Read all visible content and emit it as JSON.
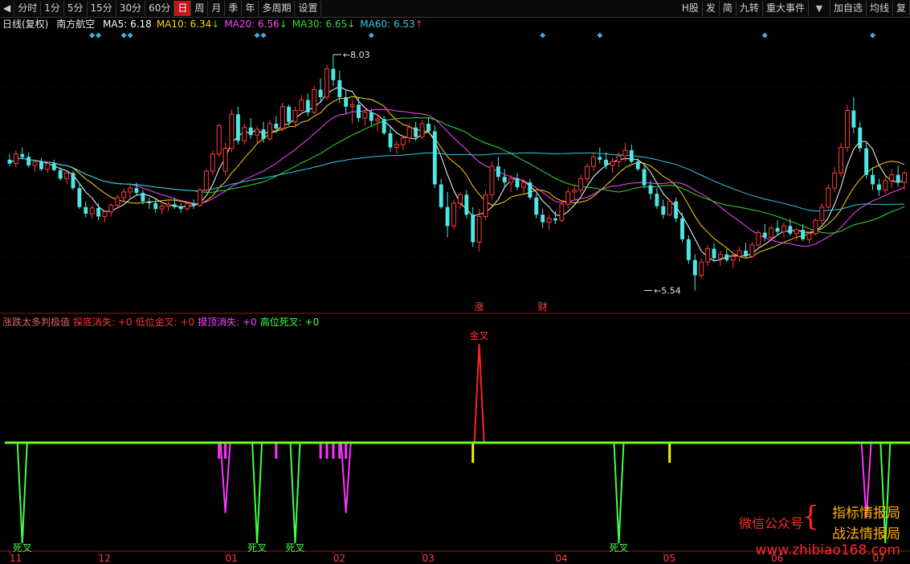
{
  "toolbar": {
    "back_icon": "arrow-left-icon",
    "periods": [
      "分时",
      "1分",
      "5分",
      "15分",
      "30分",
      "60分",
      "日",
      "周",
      "月",
      "季",
      "年",
      "多周期",
      "设置"
    ],
    "active_period": "日",
    "right_items": [
      "H股",
      "发",
      "简",
      "九转",
      "重大事件"
    ],
    "dropdown_icon": "triangle-down-icon",
    "extra_items": [
      "加自选",
      "均线",
      "复"
    ]
  },
  "main_legend": {
    "period": "日线(复权)",
    "stock": "南方航空",
    "ma": [
      {
        "label": "MA5: 6.18",
        "arrow": "",
        "color": "#ffffff"
      },
      {
        "label": "MA10: 6.34",
        "arrow": "↓",
        "color": "#ffd700"
      },
      {
        "label": "MA20: 6.56",
        "arrow": "↓",
        "color": "#ff44ff"
      },
      {
        "label": "MA30: 6.65",
        "arrow": "↓",
        "color": "#33dd33"
      },
      {
        "label": "MA60: 6.53",
        "arrow": "↑",
        "color": "#36c8e8"
      }
    ]
  },
  "indicator_legend": [
    {
      "text": "涨跌太多判极值",
      "color": "#e06060"
    },
    {
      "text": "探底消失: +0",
      "color": "#ff3333"
    },
    {
      "text": "低位金叉: +0",
      "color": "#ff3333"
    },
    {
      "text": "摸顶消失: +0",
      "color": "#ff44ff"
    },
    {
      "text": "高位死叉: +0",
      "color": "#44ff44"
    }
  ],
  "chart_data": {
    "type": "candlestick",
    "title": "南方航空 日线(复权)",
    "n_bars": 142,
    "ylim": [
      5.4,
      8.25
    ],
    "price_annotations": [
      {
        "label": "8.03",
        "bar": 51,
        "value": 8.03,
        "kind": "high"
      },
      {
        "label": "5.54",
        "bar": 100,
        "value": 5.54,
        "kind": "low"
      }
    ],
    "candles": [
      [
        6.92,
        6.98,
        6.85,
        6.88
      ],
      [
        6.88,
        7.02,
        6.84,
        6.98
      ],
      [
        6.98,
        7.05,
        6.92,
        6.95
      ],
      [
        6.95,
        7.0,
        6.84,
        6.86
      ],
      [
        6.86,
        6.92,
        6.79,
        6.9
      ],
      [
        6.9,
        6.94,
        6.8,
        6.82
      ],
      [
        6.82,
        6.9,
        6.78,
        6.88
      ],
      [
        6.88,
        6.92,
        6.8,
        6.81
      ],
      [
        6.81,
        6.84,
        6.7,
        6.72
      ],
      [
        6.72,
        6.8,
        6.66,
        6.78
      ],
      [
        6.78,
        6.8,
        6.6,
        6.62
      ],
      [
        6.62,
        6.66,
        6.4,
        6.42
      ],
      [
        6.42,
        6.48,
        6.31,
        6.35
      ],
      [
        6.35,
        6.44,
        6.3,
        6.41
      ],
      [
        6.41,
        6.46,
        6.28,
        6.32
      ],
      [
        6.32,
        6.38,
        6.26,
        6.37
      ],
      [
        6.37,
        6.46,
        6.32,
        6.44
      ],
      [
        6.44,
        6.55,
        6.4,
        6.52
      ],
      [
        6.52,
        6.62,
        6.48,
        6.58
      ],
      [
        6.58,
        6.66,
        6.52,
        6.62
      ],
      [
        6.62,
        6.68,
        6.54,
        6.57
      ],
      [
        6.57,
        6.6,
        6.45,
        6.48
      ],
      [
        6.48,
        6.52,
        6.4,
        6.46
      ],
      [
        6.46,
        6.5,
        6.36,
        6.4
      ],
      [
        6.4,
        6.45,
        6.34,
        6.43
      ],
      [
        6.43,
        6.48,
        6.38,
        6.45
      ],
      [
        6.45,
        6.52,
        6.4,
        6.42
      ],
      [
        6.42,
        6.46,
        6.36,
        6.4
      ],
      [
        6.4,
        6.48,
        6.38,
        6.46
      ],
      [
        6.46,
        6.5,
        6.4,
        6.44
      ],
      [
        6.44,
        6.62,
        6.42,
        6.6
      ],
      [
        6.6,
        6.82,
        6.58,
        6.8
      ],
      [
        6.8,
        7.02,
        6.76,
        6.98
      ],
      [
        6.98,
        7.3,
        6.95,
        7.28
      ],
      [
        6.8,
        7.1,
        6.76,
        7.04
      ],
      [
        7.04,
        7.45,
        7.0,
        7.4
      ],
      [
        7.4,
        7.48,
        7.08,
        7.12
      ],
      [
        7.12,
        7.3,
        7.08,
        7.26
      ],
      [
        7.26,
        7.36,
        7.14,
        7.18
      ],
      [
        7.18,
        7.28,
        7.1,
        7.24
      ],
      [
        7.24,
        7.32,
        7.1,
        7.14
      ],
      [
        7.14,
        7.34,
        7.12,
        7.3
      ],
      [
        7.3,
        7.38,
        7.2,
        7.25
      ],
      [
        7.25,
        7.52,
        7.22,
        7.48
      ],
      [
        7.48,
        7.5,
        7.28,
        7.32
      ],
      [
        7.32,
        7.48,
        7.26,
        7.44
      ],
      [
        7.44,
        7.6,
        7.4,
        7.55
      ],
      [
        7.55,
        7.62,
        7.38,
        7.42
      ],
      [
        7.42,
        7.7,
        7.4,
        7.66
      ],
      [
        7.66,
        7.78,
        7.52,
        7.58
      ],
      [
        7.58,
        7.92,
        7.55,
        7.88
      ],
      [
        7.88,
        8.03,
        7.7,
        7.76
      ],
      [
        7.76,
        7.86,
        7.52,
        7.58
      ],
      [
        7.58,
        7.66,
        7.4,
        7.48
      ],
      [
        7.48,
        7.56,
        7.3,
        7.5
      ],
      [
        7.5,
        7.58,
        7.32,
        7.36
      ],
      [
        7.36,
        7.45,
        7.28,
        7.42
      ],
      [
        7.42,
        7.46,
        7.28,
        7.33
      ],
      [
        7.33,
        7.4,
        7.22,
        7.35
      ],
      [
        7.35,
        7.38,
        7.18,
        7.2
      ],
      [
        7.2,
        7.28,
        7.0,
        7.05
      ],
      [
        7.05,
        7.12,
        6.98,
        7.08
      ],
      [
        7.08,
        7.18,
        7.02,
        7.15
      ],
      [
        7.15,
        7.3,
        7.1,
        7.26
      ],
      [
        7.26,
        7.32,
        7.12,
        7.16
      ],
      [
        7.16,
        7.34,
        7.14,
        7.3
      ],
      [
        7.3,
        7.36,
        7.2,
        7.22
      ],
      [
        7.22,
        7.28,
        6.62,
        6.66
      ],
      [
        6.66,
        6.72,
        6.4,
        6.42
      ],
      [
        6.42,
        6.58,
        6.1,
        6.22
      ],
      [
        6.22,
        6.5,
        6.18,
        6.46
      ],
      [
        6.46,
        6.58,
        6.4,
        6.55
      ],
      [
        6.55,
        6.6,
        6.3,
        6.34
      ],
      [
        6.34,
        6.42,
        6.0,
        6.05
      ],
      [
        6.05,
        6.4,
        5.95,
        6.32
      ],
      [
        6.32,
        6.6,
        6.28,
        6.55
      ],
      [
        6.55,
        6.9,
        6.5,
        6.85
      ],
      [
        6.85,
        6.95,
        6.7,
        6.74
      ],
      [
        6.74,
        6.82,
        6.62,
        6.68
      ],
      [
        6.68,
        6.76,
        6.58,
        6.72
      ],
      [
        6.72,
        6.78,
        6.6,
        6.63
      ],
      [
        6.63,
        6.72,
        6.56,
        6.68
      ],
      [
        6.68,
        6.72,
        6.5,
        6.52
      ],
      [
        6.52,
        6.56,
        6.3,
        6.34
      ],
      [
        6.34,
        6.4,
        6.2,
        6.26
      ],
      [
        6.26,
        6.34,
        6.18,
        6.3
      ],
      [
        6.3,
        6.38,
        6.24,
        6.28
      ],
      [
        6.28,
        6.48,
        6.26,
        6.45
      ],
      [
        6.45,
        6.62,
        6.4,
        6.58
      ],
      [
        6.58,
        6.66,
        6.5,
        6.6
      ],
      [
        6.6,
        6.76,
        6.56,
        6.72
      ],
      [
        6.72,
        6.88,
        6.68,
        6.85
      ],
      [
        6.85,
        7.0,
        6.8,
        6.95
      ],
      [
        6.95,
        7.05,
        6.88,
        6.92
      ],
      [
        6.92,
        7.0,
        6.82,
        6.86
      ],
      [
        6.86,
        6.94,
        6.78,
        6.9
      ],
      [
        6.9,
        7.0,
        6.84,
        6.96
      ],
      [
        6.96,
        7.1,
        6.9,
        7.02
      ],
      [
        7.02,
        7.08,
        6.88,
        6.9
      ],
      [
        6.9,
        6.94,
        6.8,
        6.82
      ],
      [
        6.82,
        6.86,
        6.62,
        6.65
      ],
      [
        6.65,
        6.7,
        6.5,
        6.56
      ],
      [
        6.56,
        6.62,
        6.4,
        6.43
      ],
      [
        6.43,
        6.5,
        6.3,
        6.34
      ],
      [
        6.34,
        6.5,
        6.32,
        6.48
      ],
      [
        6.48,
        6.52,
        6.26,
        6.3
      ],
      [
        6.3,
        6.36,
        6.05,
        6.08
      ],
      [
        6.08,
        6.12,
        5.82,
        5.86
      ],
      [
        5.86,
        5.92,
        5.54,
        5.7
      ],
      [
        5.7,
        5.88,
        5.66,
        5.84
      ],
      [
        5.84,
        6.02,
        5.8,
        5.98
      ],
      [
        5.98,
        6.04,
        5.84,
        5.88
      ],
      [
        5.88,
        5.96,
        5.8,
        5.92
      ],
      [
        5.92,
        5.98,
        5.84,
        5.86
      ],
      [
        5.86,
        5.94,
        5.78,
        5.9
      ],
      [
        5.9,
        6.0,
        5.84,
        5.96
      ],
      [
        5.96,
        6.04,
        5.88,
        5.9
      ],
      [
        5.9,
        6.05,
        5.88,
        6.02
      ],
      [
        6.02,
        6.18,
        6.0,
        6.15
      ],
      [
        6.15,
        6.24,
        6.06,
        6.1
      ],
      [
        6.1,
        6.22,
        6.08,
        6.2
      ],
      [
        6.2,
        6.28,
        6.12,
        6.16
      ],
      [
        6.16,
        6.26,
        6.1,
        6.22
      ],
      [
        6.22,
        6.3,
        6.12,
        6.14
      ],
      [
        6.14,
        6.2,
        6.06,
        6.18
      ],
      [
        6.18,
        6.24,
        6.06,
        6.08
      ],
      [
        6.08,
        6.16,
        6.04,
        6.14
      ],
      [
        6.14,
        6.3,
        6.12,
        6.28
      ],
      [
        6.28,
        6.46,
        6.24,
        6.42
      ],
      [
        6.42,
        6.66,
        6.4,
        6.62
      ],
      [
        6.62,
        6.84,
        6.58,
        6.78
      ],
      [
        6.78,
        7.1,
        6.74,
        7.05
      ],
      [
        7.05,
        7.5,
        7.0,
        7.44
      ],
      [
        7.44,
        7.58,
        7.2,
        7.26
      ],
      [
        7.26,
        7.32,
        7.0,
        7.04
      ],
      [
        7.04,
        7.1,
        6.72,
        6.76
      ],
      [
        6.76,
        6.84,
        6.6,
        6.66
      ],
      [
        6.66,
        6.72,
        6.54,
        6.6
      ],
      [
        6.6,
        6.74,
        6.56,
        6.7
      ],
      [
        6.7,
        6.82,
        6.62,
        6.76
      ],
      [
        6.76,
        6.86,
        6.64,
        6.68
      ],
      [
        6.68,
        6.8,
        6.6,
        6.78
      ]
    ],
    "ma_lines": [
      {
        "name": "MA5",
        "period": 5,
        "color": "#ffffff"
      },
      {
        "name": "MA10",
        "period": 10,
        "color": "#ffd700"
      },
      {
        "name": "MA20",
        "period": 20,
        "color": "#ff44ff"
      },
      {
        "name": "MA30",
        "period": 30,
        "color": "#33dd33"
      },
      {
        "name": "MA60",
        "period": 60,
        "color": "#36c8e8"
      }
    ],
    "event_markers": [
      13,
      14,
      18,
      19,
      39,
      40,
      57,
      84,
      93,
      119,
      136
    ],
    "bottom_labels": [
      {
        "text": "涨",
        "bar": 74
      },
      {
        "text": "财",
        "bar": 84
      }
    ],
    "x_tick_labels": [
      {
        "label": "11",
        "bar": 0
      },
      {
        "label": "12",
        "bar": 14
      },
      {
        "label": "01",
        "bar": 34
      },
      {
        "label": "02",
        "bar": 51
      },
      {
        "label": "03",
        "bar": 65
      },
      {
        "label": "04",
        "bar": 86
      },
      {
        "label": "05",
        "bar": 103
      },
      {
        "label": "06",
        "bar": 120
      },
      {
        "label": "07",
        "bar": 136
      }
    ],
    "indicator": {
      "baseline": 0,
      "ylim": [
        -1,
        1
      ],
      "spikes": [
        {
          "bar": 2,
          "value": -1.0,
          "color": "#44ff44",
          "label": "死叉"
        },
        {
          "bar": 34,
          "value": -0.7,
          "color": "#ff33ff",
          "label": ""
        },
        {
          "bar": 39,
          "value": -1.0,
          "color": "#44ff44",
          "label": "死叉"
        },
        {
          "bar": 45,
          "value": -1.0,
          "color": "#44ff44",
          "label": "死叉"
        },
        {
          "bar": 53,
          "value": -0.7,
          "color": "#ff33ff",
          "label": ""
        },
        {
          "bar": 74,
          "value": 1.0,
          "color": "#ff2222",
          "label": "金叉"
        },
        {
          "bar": 96,
          "value": -1.0,
          "color": "#44ff44",
          "label": "死叉"
        },
        {
          "bar": 135,
          "value": -0.75,
          "color": "#ff33ff",
          "label": ""
        },
        {
          "bar": 138,
          "value": -1.0,
          "color": "#44ff44",
          "label": ""
        }
      ],
      "small_bars": [
        {
          "bar": 33,
          "value": -0.16,
          "color": "#ff33ff"
        },
        {
          "bar": 34,
          "value": -0.16,
          "color": "#ff33ff"
        },
        {
          "bar": 42,
          "value": -0.16,
          "color": "#ff33ff"
        },
        {
          "bar": 49,
          "value": -0.16,
          "color": "#ff33ff"
        },
        {
          "bar": 50,
          "value": -0.16,
          "color": "#ff33ff"
        },
        {
          "bar": 51,
          "value": -0.16,
          "color": "#ff33ff"
        },
        {
          "bar": 52,
          "value": -0.16,
          "color": "#ff33ff"
        },
        {
          "bar": 53,
          "value": -0.16,
          "color": "#ff33ff"
        },
        {
          "bar": 73,
          "value": -0.2,
          "color": "#ffee00"
        },
        {
          "bar": 104,
          "value": -0.2,
          "color": "#ffee00"
        }
      ]
    }
  },
  "watermark": {
    "wechat": "微信公众号",
    "name1": "指标情报局",
    "name2": "战法情报局",
    "url": "www.zhibiao168.com"
  }
}
